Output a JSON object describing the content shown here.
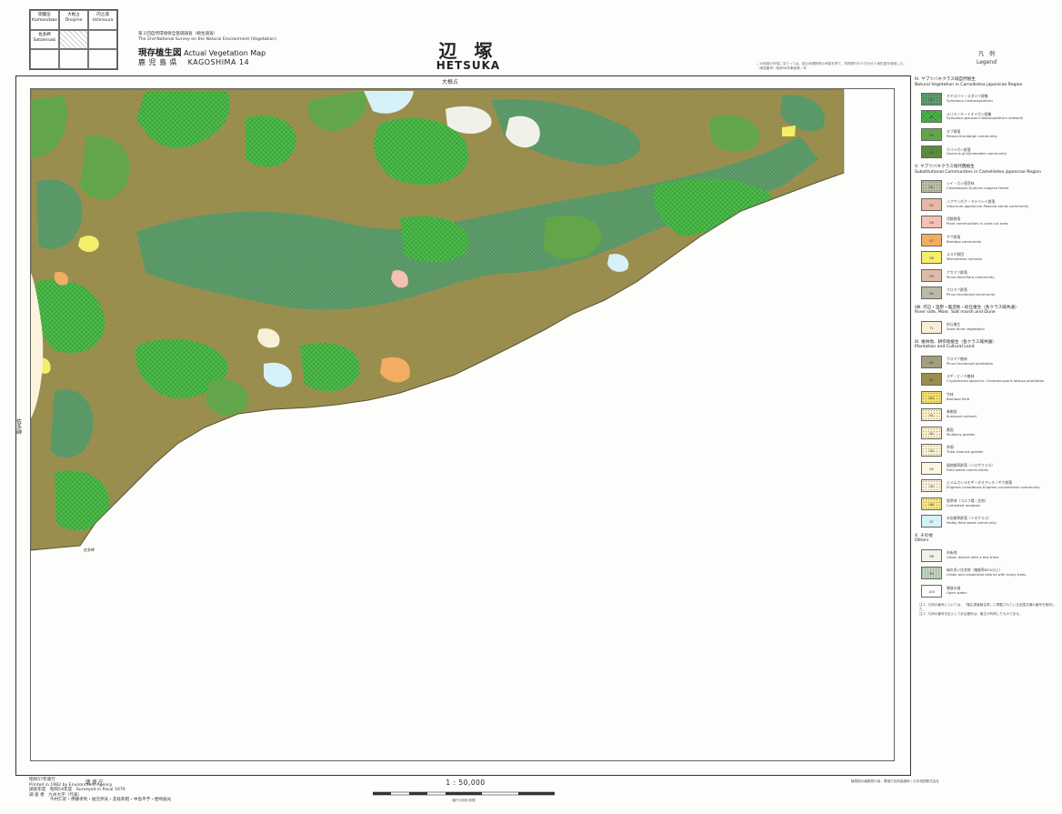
{
  "index": {
    "cells": [
      {
        "jp": "開聞岳",
        "en": "Kaimondake",
        "hatched": false
      },
      {
        "jp": "大根占",
        "en": "Ōnejime",
        "hatched": false
      },
      {
        "jp": "内之浦",
        "en": "Uchinoura",
        "hatched": false
      },
      {
        "jp": "佐多岬",
        "en": "Satamisaki",
        "hatched": false
      },
      {
        "jp": "",
        "en": "",
        "hatched": true
      },
      {
        "jp": "",
        "en": "",
        "hatched": false
      },
      {
        "jp": "",
        "en": "",
        "hatched": false
      },
      {
        "jp": "",
        "en": "",
        "hatched": false
      },
      {
        "jp": "",
        "en": "",
        "hatched": false
      }
    ]
  },
  "header": {
    "series_jp": "第２回自然環境保全基礎調査（植生調査）",
    "series_en": "The 2nd National Survey on the Natural Environment (Vegetation)",
    "map_kind_jp": "現存植生図",
    "map_kind_en": "Actual Vegetation Map",
    "sheet": "鹿 児 島 県　 KAGOSHIMA  14",
    "title_jp": "辺 塚",
    "title_en": "HETSUKA",
    "note": "この地図の作成に当たっては、国土地理院長の承認を得て、同院発行の５万分の１地形図を使用した。（承認番号）昭和56年事使第…号"
  },
  "map": {
    "label_top": "大根占",
    "label_left_1": "佐多岬",
    "label_left_2": "佐多岬",
    "label_cape": "佐多岬"
  },
  "legend": {
    "head_jp": "凡　例",
    "head_en": "Legend",
    "sections": [
      {
        "title_jp": "Ⅳ. ヤブツバキクラス域自然植生",
        "title_en": "Natural Vegetation in Camellietea japonicae Region",
        "items": [
          {
            "code": "37",
            "jp": "ミミズバイ－スダジイ群集",
            "en": "Symploco-Castanopsietum",
            "color": "#5f9e6c",
            "pattern": "dots"
          },
          {
            "code": "42",
            "jp": "ルリミノキ－イチイガシ群集",
            "en": "Symploco glaucae-Castanopsietum sieboldii",
            "color": "#4cba48",
            "pattern": "cross"
          },
          {
            "code": "44",
            "jp": "タブ群落",
            "en": "Persea thunbergii community",
            "color": "#63a64a",
            "pattern": "none"
          },
          {
            "code": "45",
            "jp": "ウバメガシ群落",
            "en": "Quercus phillyraeoides community",
            "color": "#5c8a3c",
            "pattern": "none"
          }
        ]
      },
      {
        "title_jp": "Ⅴ. ヤブツバキクラス域代償植生",
        "title_en": "Substitutional Communities in Camellietea japonicae Region",
        "items": [
          {
            "code": "51",
            "jp": "シイ・カシ萌芽林",
            "en": "Castanopsis-Quercus coppice forest",
            "color": "#b9c0a4",
            "pattern": "dots"
          },
          {
            "code": "52",
            "jp": "ハクサンボク－マテバシイ群落",
            "en": "Viburnum japonicum-Pasania edulis community",
            "color": "#e6b9a6",
            "pattern": "none"
          },
          {
            "code": "56",
            "jp": "伐跡群落",
            "en": "Plant communities in clear-cut area",
            "color": "#f3c0b4",
            "pattern": "none"
          },
          {
            "code": "57",
            "jp": "ササ群落",
            "en": "Bamboo community",
            "color": "#f2ad63",
            "pattern": "none"
          },
          {
            "code": "58",
            "jp": "ススキ群団",
            "en": "Miscanthion sinensis",
            "color": "#f4ee68",
            "pattern": "none"
          },
          {
            "code": "59",
            "jp": "アカマツ群落",
            "en": "Pinus densiflora community",
            "color": "#e0b9a9",
            "pattern": "none"
          },
          {
            "code": "60",
            "jp": "クロマツ群落",
            "en": "Pinus thunbergii community",
            "color": "#bcb9a7",
            "pattern": "none"
          }
        ]
      },
      {
        "title_jp": "Ⅷ. 河辺・湿原・塩沼地・砂丘植生（各クラス域共通）",
        "title_en": "River side, Moor, Salt marsh and Dune",
        "items": [
          {
            "code": "71",
            "jp": "砂丘植生",
            "en": "Sand dune vegetation",
            "color": "#f8efd8",
            "pattern": "none"
          }
        ]
      },
      {
        "title_jp": "Ⅸ. 植林地、耕作地植生（各クラス域共通）",
        "title_en": "Plantation and Cultural Land",
        "items": [
          {
            "code": "80",
            "jp": "クロマツ植林",
            "en": "Pinus thunbergii plantation",
            "color": "#a29e7e",
            "pattern": "none"
          },
          {
            "code": "81",
            "jp": "スギ・ヒノキ植林",
            "en": "Cryptomeria japonica, Chamaecyparis obtusa plantation",
            "color": "#9a8e4e",
            "pattern": "none"
          },
          {
            "code": "83",
            "jp": "竹林",
            "en": "Bamboo field",
            "color": "#f4df6e",
            "pattern": "dots"
          },
          {
            "code": "91",
            "jp": "果樹園",
            "en": "Kumquat orchard",
            "color": "#fbf2c6",
            "pattern": "dots"
          },
          {
            "code": "92",
            "jp": "桑園",
            "en": "Mulberry garden",
            "color": "#fbf0ce",
            "pattern": "dots"
          },
          {
            "code": "93",
            "jp": "茶畑",
            "en": "Thea sinensis garden",
            "color": "#fbf3d2",
            "pattern": "dots"
          },
          {
            "code": "94",
            "jp": "畑地雑草群落（シロザクラス）",
            "en": "Field weed communities",
            "color": "#fdf7df",
            "pattern": "none"
          },
          {
            "code": "95",
            "jp": "ヒメムカシヨモギ－オオアレチノギク群落",
            "en": "Erigeron canadensis-Erigeron sumatrensis community",
            "color": "#fbf3dd",
            "pattern": "dots"
          },
          {
            "code": "96",
            "jp": "牧草地（ゴルフ場・芝地）",
            "en": "Cultivated meadow",
            "color": "#f7e687",
            "pattern": "dots"
          },
          {
            "code": "97",
            "jp": "水田雑草群落（イネクラス）",
            "en": "Paddy field weed community",
            "color": "#d6f1f8",
            "pattern": "none"
          }
        ]
      },
      {
        "title_jp": "Ⅹ. その他",
        "title_en": "Others",
        "items": [
          {
            "code": "98",
            "jp": "市街地",
            "en": "Urban district with a few trees",
            "color": "#f1f1ea",
            "pattern": "none"
          },
          {
            "code": "99",
            "jp": "緑の多い住宅地（植被率60%以上）",
            "en": "Urban and residential district with many trees",
            "color": "#c3d6c2",
            "pattern": "lines"
          },
          {
            "code": "100",
            "jp": "開放水域",
            "en": "Open water",
            "color": "#ffffff",
            "pattern": "none"
          }
        ]
      }
    ],
    "notes": [
      "注１. 凡例の番号については、「植生調査報告書」に掲載されている全国共通の番号を使用した。",
      "注２. 凡例の番号を記入してある箇所は、植生が判明したものである。"
    ]
  },
  "footer": {
    "line1": "昭和57年発行",
    "line2": "Printed in 1982 by Environment Agency",
    "line3": "調査年度　昭和54年度　Surveyed in fiscal 1979",
    "line4": "調 査 者　九州大学（代表）",
    "line5": "　　　　　今村仁史・伊藤孝利・福元伸夫・友枝和昭・中島平予・岩崎倫光",
    "agency": "環 境 庁",
    "agency_en": "by Environment Agency",
    "scale": "1 : 50,000",
    "scale_note": "縮尺凡例を参照",
    "printer": "植物図の編集発行者：環境庁自然保護局 / 日本地図株式会社"
  }
}
